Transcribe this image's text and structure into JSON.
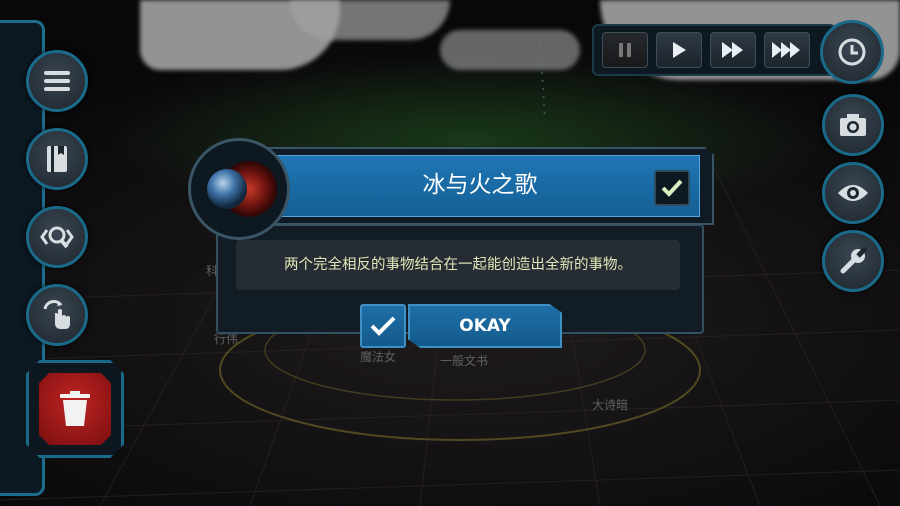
{
  "scene": {
    "orbit_labels": [
      "行伟",
      "魔法女",
      "一般文书",
      "大诗暗",
      "科"
    ]
  },
  "speed_controls": {
    "buttons": [
      {
        "icon": "pause-icon",
        "state": "paused"
      },
      {
        "icon": "play-icon"
      },
      {
        "icon": "fast-forward-icon"
      },
      {
        "icon": "fastest-forward-icon"
      }
    ]
  },
  "left_toolbar": {
    "buttons": [
      "menu-icon",
      "book-icon",
      "search-icon",
      "swipe-gesture-icon"
    ],
    "trash": "trash-icon"
  },
  "right_toolbar": {
    "buttons": [
      "clock-icon",
      "camera-icon",
      "eye-icon",
      "wrench-icon"
    ]
  },
  "dialog": {
    "title": "冰与火之歌",
    "message": "两个完全相反的事物结合在一起能创造出全新的事物。",
    "okay_label": "OKAY"
  },
  "colors": {
    "accent_blue": "#1f76b4",
    "frame": "#1a6a8a",
    "trash_red": "#c02424",
    "message_text": "#dfe8b8"
  }
}
